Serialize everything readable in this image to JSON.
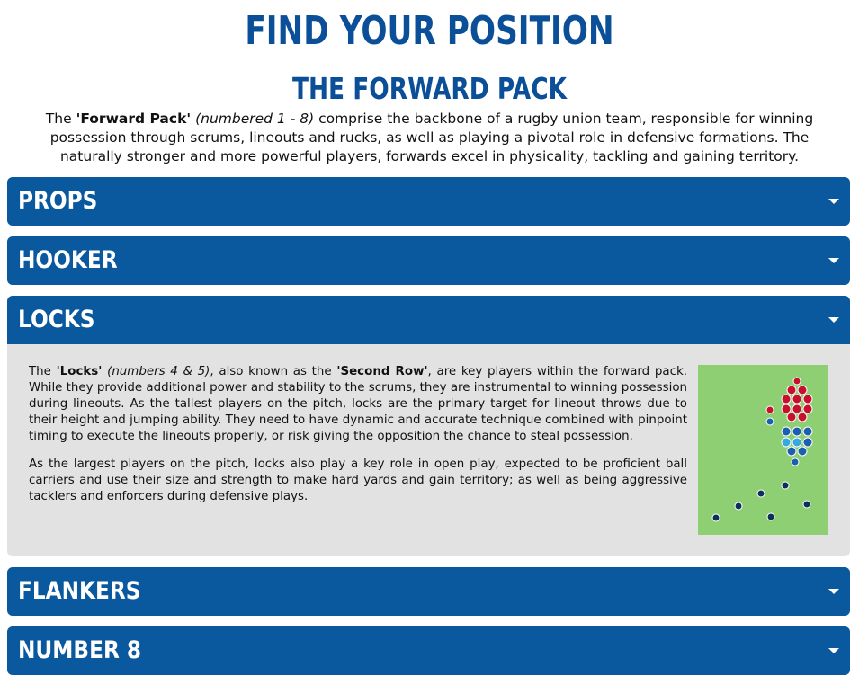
{
  "header": {
    "title": "FIND YOUR POSITION",
    "subtitle": "THE FORWARD PACK"
  },
  "intro": {
    "pre": "The ",
    "bold": "'Forward Pack'",
    "italic": " (numbered 1 - 8)",
    "rest": " comprise the backbone of a rugby union team, responsible for winning possession through scrums, lineouts and rucks, as well as playing a pivotal role in defensive formations. The naturally stronger and more powerful players, forwards excel in physicality, tackling and gaining territory."
  },
  "accordions": [
    {
      "label": "PROPS",
      "open": false
    },
    {
      "label": "HOOKER",
      "open": false
    },
    {
      "label": "LOCKS",
      "open": true
    },
    {
      "label": "FLANKERS",
      "open": false
    },
    {
      "label": "NUMBER 8",
      "open": false
    }
  ],
  "locks_panel": {
    "p1_pre": "The ",
    "p1_bold1": "'Locks'",
    "p1_italic": " (numbers 4 & 5)",
    "p1_mid": ", also known as the ",
    "p1_bold2": "'Second Row'",
    "p1_rest": ", are key players within the forward pack. While they provide additional power and stability to the scrums, they are instrumental to winning possession during lineouts. As the tallest players on the pitch, locks are the primary target for lineout throws due to their height and jumping ability. They need to have dynamic and accurate technique combined with pinpoint timing to execute the lineouts properly, or risk giving the opposition the chance to steal possession.",
    "p2": "As the largest players on the pitch, locks also play a key role in open play, expected to be proficient ball carriers and use their size and strength to make hard yards and gain territory; as well as being aggressive tacklers and enforcers during defensive plays."
  },
  "colors": {
    "brand_blue": "#0a4f98",
    "accordion_blue": "#0a589e",
    "panel_grey": "#e2e2e2",
    "pitch_green": "#8fcf73"
  },
  "icons": {
    "caret": "chevron-down-icon"
  }
}
